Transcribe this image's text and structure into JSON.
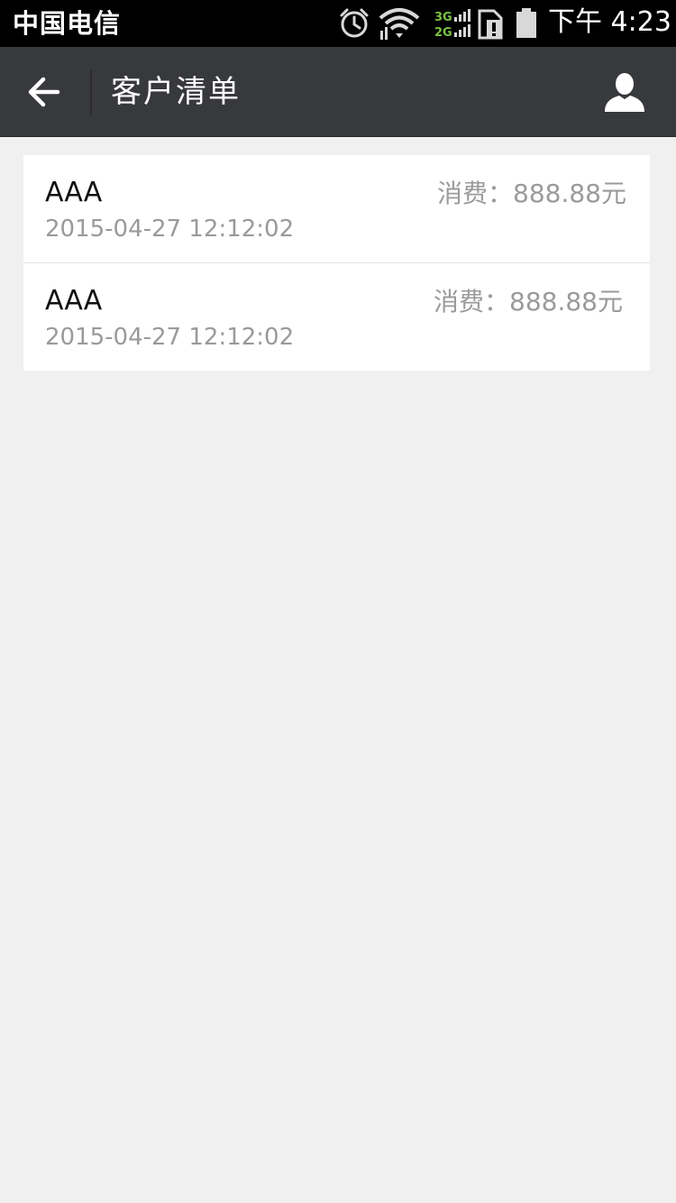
{
  "status_bar": {
    "carrier": "中国电信",
    "network_top": "3G",
    "network_bottom": "2G",
    "time": "下午 4:23",
    "icons": [
      "alarm-icon",
      "wifi-icon",
      "signal-icon",
      "sim-alert-icon",
      "battery-icon"
    ],
    "network_color": "#7ac143"
  },
  "nav": {
    "title": "客户清单",
    "back_icon": "arrow-left-icon",
    "profile_icon": "user-icon",
    "background": "#38393d"
  },
  "customers": [
    {
      "name": "AAA",
      "time": "2015-04-27 12:12:02",
      "spend": "消费：888.88元"
    },
    {
      "name": "AAA",
      "time": "2015-04-27 12:12:02",
      "spend": "消费：888.88元"
    }
  ]
}
